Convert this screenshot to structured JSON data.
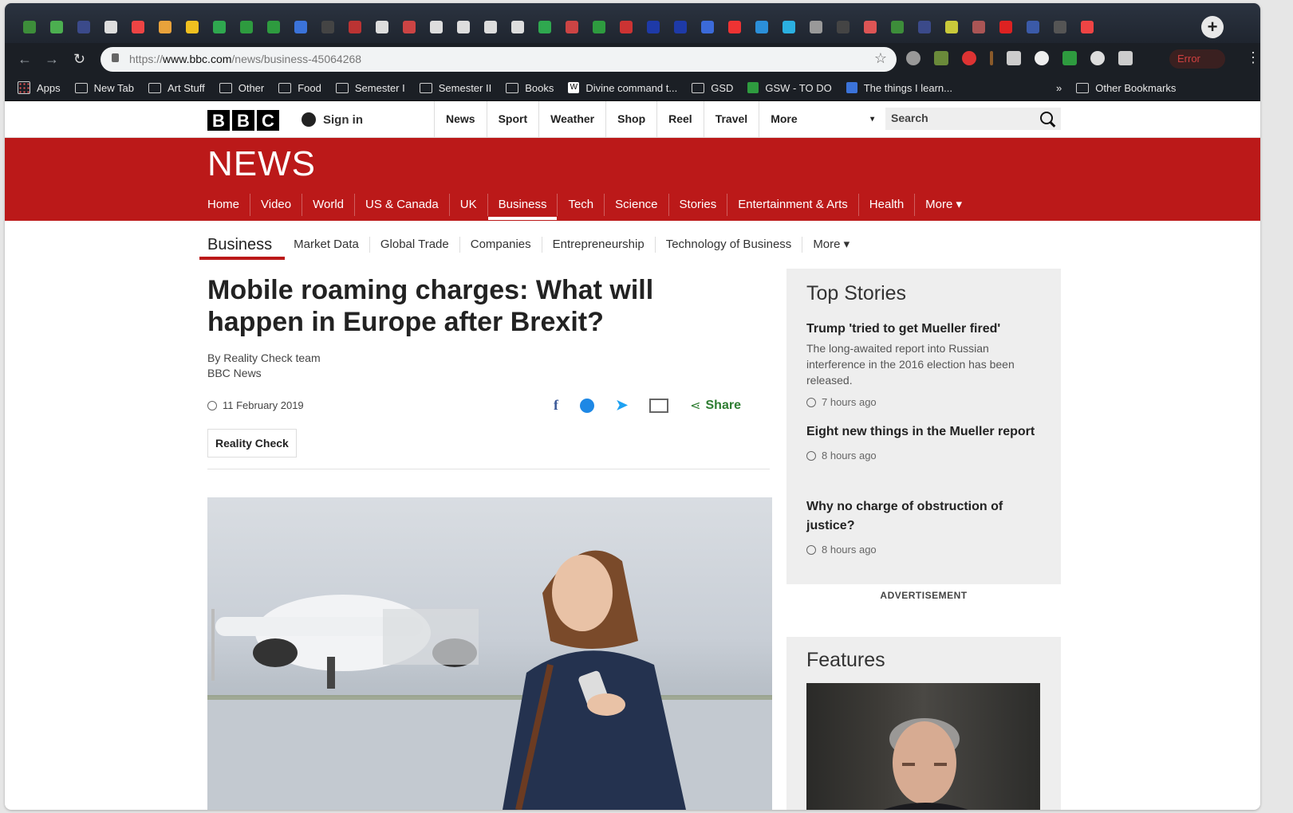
{
  "browser": {
    "url_prefix": "https://",
    "url_domain": "www.bbc.com",
    "url_path": "/news/business-45064268",
    "error_label": "Error",
    "tab_colors": [
      "#3d8d3a",
      "#4caf50",
      "#3b4a8a",
      "#ddd",
      "#e44",
      "#e9a23b",
      "#f0c020",
      "#2fa84f",
      "#2e9b3f",
      "#2e9b3f",
      "#3b73d9",
      "#444",
      "#b33",
      "#ddd",
      "#c44",
      "#ddd",
      "#ddd",
      "#ddd",
      "#ddd",
      "#2fa84f",
      "#c44",
      "#2e9b3f",
      "#c33",
      "#1e3aa8",
      "#1e3aa8",
      "#3b6ad9",
      "#e33",
      "#2b8fd9",
      "#2bb0e0",
      "#999",
      "#444",
      "#d55",
      "#3d8d3a",
      "#3b4a8a",
      "#c9c93a",
      "#a55",
      "#d22",
      "#3b5aa8",
      "#555",
      "#e44"
    ]
  },
  "bookmarks": [
    {
      "label": "Apps",
      "icon": "apps-icon"
    },
    {
      "label": "New Tab",
      "icon": "page-icon"
    },
    {
      "label": "Art Stuff",
      "icon": "folder-icon"
    },
    {
      "label": "Other",
      "icon": "folder-icon"
    },
    {
      "label": "Food",
      "icon": "folder-icon"
    },
    {
      "label": "Semester I",
      "icon": "folder-icon"
    },
    {
      "label": "Semester II",
      "icon": "folder-icon"
    },
    {
      "label": "Books",
      "icon": "folder-icon"
    },
    {
      "label": "Divine command t...",
      "icon": "wikipedia-icon"
    },
    {
      "label": "GSD",
      "icon": "folder-icon"
    },
    {
      "label": "GSW - TO DO",
      "icon": "sheets-icon"
    },
    {
      "label": "The things I learn...",
      "icon": "docs-icon"
    }
  ],
  "bookmarks_overflow": "»",
  "other_bookmarks": "Other Bookmarks",
  "bbc": {
    "logo": [
      "B",
      "B",
      "C"
    ],
    "sign_in": "Sign in",
    "top_nav": [
      "News",
      "Sport",
      "Weather",
      "Shop",
      "Reel",
      "Travel",
      "More"
    ],
    "search_placeholder": "Search",
    "news_word": "NEWS",
    "news_nav": [
      "Home",
      "Video",
      "World",
      "US & Canada",
      "UK",
      "Business",
      "Tech",
      "Science",
      "Stories",
      "Entertainment & Arts",
      "Health",
      "More ▾"
    ],
    "sub_section": "Business",
    "sub_nav": [
      "Market Data",
      "Global Trade",
      "Companies",
      "Entrepreneurship",
      "Technology of Business",
      "More ▾"
    ]
  },
  "article": {
    "headline": "Mobile roaming charges: What will happen in Europe after Brexit?",
    "byline_1": "By Reality Check team",
    "byline_2": "BBC News",
    "date": "11 February 2019",
    "share_label": "Share",
    "tag": "Reality Check"
  },
  "sidebar": {
    "top_stories_title": "Top Stories",
    "stories": [
      {
        "headline": "Trump 'tried to get Mueller fired'",
        "summary": "The long-awaited report into Russian interference in the 2016 election has been released.",
        "time": "7 hours ago"
      },
      {
        "headline": "Eight new things in the Mueller report",
        "summary": "",
        "time": "8 hours ago"
      },
      {
        "headline": "Why no charge of obstruction of justice?",
        "summary": "",
        "time": "8 hours ago"
      }
    ],
    "advertisement": "ADVERTISEMENT",
    "features_title": "Features"
  }
}
